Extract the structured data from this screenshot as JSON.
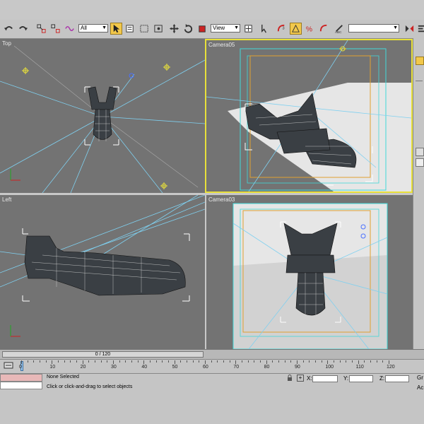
{
  "toolbar": {
    "selection_filter": "All",
    "reference_coord": "View",
    "named_selection": ""
  },
  "viewports": {
    "top": {
      "label": "Top"
    },
    "camera05": {
      "label": "Camera05"
    },
    "left": {
      "label": "Left"
    },
    "camera03": {
      "label": "Camera03"
    }
  },
  "time_slider": {
    "label": "0 / 120"
  },
  "trackbar": {
    "ticks": [
      "0",
      "10",
      "20",
      "30",
      "40",
      "50",
      "60",
      "70",
      "80",
      "90",
      "100",
      "110",
      "120"
    ]
  },
  "status": {
    "selection": "None Selected",
    "prompt": "Click or click-and-drag to select objects",
    "x_label": "X:",
    "y_label": "Y:",
    "z_label": "Z:",
    "right_top": "Gr",
    "right_bottom": "Ac"
  },
  "colors": {
    "viewport_bg": "#737373",
    "active_border": "#e8e03a",
    "camera_line": "#7fd0f0",
    "safe_frame_outer": "#40d8d8",
    "safe_frame_inner": "#e0a030"
  }
}
